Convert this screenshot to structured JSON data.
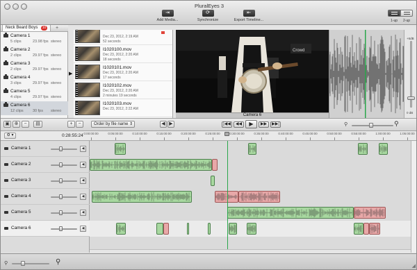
{
  "window": {
    "title": "PluralEyes 3"
  },
  "toolbar": {
    "add_media_label": "Add Media...",
    "synchronize_label": "Synchronize",
    "export_timeline_label": "Export Timeline...",
    "view_1up_label": "1-up",
    "view_2up_label": "2-up",
    "add_media_icon": "add-media-icon",
    "synchronize_icon": "sync-icon",
    "export_icon": "export-icon"
  },
  "project": {
    "tab_label": "Neck Beard Boys",
    "badge": "10",
    "add_tab_label": "+"
  },
  "cameras": [
    {
      "name": "Camera 1",
      "clips": "5 clips",
      "fps": "23.98 fps",
      "audio": "stereo"
    },
    {
      "name": "Camera 2",
      "clips": "2 clips",
      "fps": "29.97 fps",
      "audio": "stereo"
    },
    {
      "name": "Camera 3",
      "clips": "2 clips",
      "fps": "29.97 fps",
      "audio": "stereo"
    },
    {
      "name": "Camera 4",
      "clips": "3 clips",
      "fps": "29.97 fps",
      "audio": "stereo"
    },
    {
      "name": "Camera 5",
      "clips": "4 clips",
      "fps": "29.97 fps",
      "audio": "stereo"
    },
    {
      "name": "Camera 6",
      "clips": "12 clips",
      "fps": "30 fps",
      "audio": "stereo"
    }
  ],
  "clips": [
    {
      "name": "",
      "date": "Dec 23, 2012, 2:19 AM",
      "duration": "52 seconds"
    },
    {
      "name": "I1020100.mov",
      "date": "Dec 23, 2012, 2:20 AM",
      "duration": "18 seconds"
    },
    {
      "name": "I1020101.mov",
      "date": "Dec 23, 2012, 2:20 AM",
      "duration": "17 seconds"
    },
    {
      "name": "I1020102.mov",
      "date": "Dec 23, 2012, 2:20 AM",
      "duration": "2 minutes 19 seconds"
    },
    {
      "name": "I1020103.mov",
      "date": "Dec 23, 2012, 2:22 AM",
      "duration": ""
    }
  ],
  "preview": {
    "camera_label": "Camera 6",
    "volume_top": "+6dB",
    "volume_bottom": "0 dB"
  },
  "controls": {
    "sort_label": "Order by file name",
    "add_label": "+",
    "remove_label": "−",
    "prev_label": "◀",
    "next_label": "▶",
    "transport": {
      "start": "|◀◀",
      "back": "◀◀",
      "play": "▶",
      "forward": "▶▶",
      "end": "▶▶|"
    },
    "gear_label": "⚙ ▾",
    "total_duration": "0:28:55:24"
  },
  "ruler": {
    "labels": [
      "0:00:00:00",
      "0:05:00:00",
      "0:10:00:00",
      "0:15:00:00",
      "0:20:00:00",
      "0:25:00:00",
      "0:30:00:00",
      "0:35:00:00",
      "0:40:00:00",
      "0:45:00:00",
      "0:50:00:00",
      "0:55:00:00",
      "1:00:00:00",
      "1:05:00:00"
    ]
  },
  "tracks": [
    {
      "name": "Camera 1"
    },
    {
      "name": "Camera 2"
    },
    {
      "name": "Camera 3"
    },
    {
      "name": "Camera 4"
    },
    {
      "name": "Camera 5"
    },
    {
      "name": "Camera 6"
    }
  ],
  "colors": {
    "synced_clip": "#a8d8a0",
    "unsynced_clip": "#e8a8a8",
    "playhead": "#2aa64b",
    "badge": "#d9312b"
  },
  "icons": {
    "zoom_out": "zoom-out-icon",
    "zoom_in": "zoom-in-icon",
    "camera": "camera-icon",
    "speaker": "speaker-icon"
  }
}
